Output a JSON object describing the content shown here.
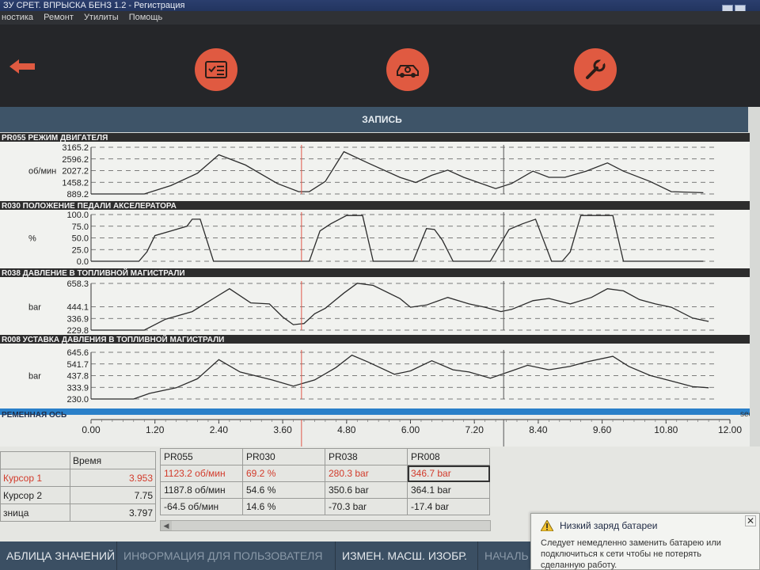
{
  "window": {
    "title": "ЗУ СРЕТ. ВПРЫСКА БЕНЗ 1.2 - Регистрация"
  },
  "menu": [
    "ностика",
    "Ремонт",
    "Утилиты",
    "Помощь"
  ],
  "toolbar": {
    "buttons": [
      {
        "icon": "checklist-icon"
      },
      {
        "icon": "engine-icon"
      },
      {
        "icon": "wrench-icon"
      }
    ],
    "back_icon": "back-arrow-icon",
    "accent": "#e05a41"
  },
  "section_title": "ЗАПИСЬ",
  "time_axis": {
    "title": "РЕМЕННАЯ ОСЬ",
    "unit": "sec",
    "ticks": [
      "0.00",
      "1.20",
      "2.40",
      "3.60",
      "4.80",
      "6.00",
      "7.20",
      "8.40",
      "9.60",
      "10.80",
      "12.00"
    ]
  },
  "chart_data": [
    {
      "type": "line",
      "title": "PR055 РЕЖИМ ДВИГАТЕЛЯ",
      "ylabel": "об/мин",
      "yticks": [
        "3165.2",
        "2596.2",
        "2027.2",
        "1458.2",
        "889.2"
      ],
      "ylim": [
        889.2,
        3165.2
      ],
      "xlim": [
        0,
        12
      ],
      "x": [
        0.0,
        1.0,
        1.5,
        2.0,
        2.4,
        2.9,
        3.5,
        3.9,
        4.1,
        4.4,
        4.75,
        5.2,
        5.8,
        6.1,
        6.4,
        6.7,
        7.0,
        7.6,
        7.9,
        8.3,
        8.6,
        8.9,
        9.3,
        9.7,
        10.0,
        10.5,
        10.9,
        11.5
      ],
      "series": [
        {
          "values": [
            889,
            889,
            1300,
            1900,
            2800,
            2300,
            1400,
            1000,
            1000,
            1500,
            2950,
            2400,
            1700,
            1450,
            1800,
            2050,
            1700,
            1150,
            1400,
            2000,
            1700,
            1700,
            2000,
            2400,
            2000,
            1500,
            1000,
            950
          ]
        }
      ],
      "color": "#2b2b2b"
    },
    {
      "type": "line",
      "title": "R030 ПОЛОЖЕНИЕ ПЕДАЛИ АКСЕЛЕРАТОРА",
      "ylabel": "%",
      "yticks": [
        "100.0",
        "75.0",
        "50.0",
        "25.0",
        "0.0"
      ],
      "ylim": [
        0,
        100
      ],
      "xlim": [
        0,
        12
      ],
      "x": [
        0.0,
        0.9,
        1.05,
        1.2,
        1.5,
        1.8,
        1.9,
        2.05,
        2.3,
        2.6,
        4.1,
        4.3,
        4.5,
        4.8,
        5.1,
        5.3,
        6.05,
        6.3,
        6.45,
        6.6,
        6.8,
        7.5,
        7.85,
        8.1,
        8.35,
        8.65,
        8.85,
        9.0,
        9.2,
        9.8,
        10.0,
        10.2,
        11.5
      ],
      "series": [
        {
          "values": [
            0,
            0,
            20,
            55,
            65,
            75,
            90,
            90,
            0,
            0,
            0,
            65,
            80,
            98,
            98,
            0,
            0,
            70,
            68,
            45,
            0,
            0,
            68,
            80,
            90,
            0,
            0,
            20,
            98,
            98,
            0,
            0,
            0
          ]
        }
      ],
      "color": "#2b2b2b"
    },
    {
      "type": "line",
      "title": "R038 ДАВЛЕНИЕ В ТОПЛИВНОЙ МАГИСТРАЛИ",
      "ylabel": "bar",
      "yticks": [
        "658.3",
        "444.1",
        "336.9",
        "229.8"
      ],
      "ylim": [
        229.8,
        658.3
      ],
      "xlim": [
        0,
        12
      ],
      "x": [
        0.0,
        1.0,
        1.4,
        1.9,
        2.3,
        2.6,
        3.0,
        3.35,
        3.6,
        3.8,
        4.0,
        4.2,
        4.4,
        4.75,
        5.0,
        5.3,
        5.8,
        6.0,
        6.3,
        6.7,
        7.1,
        7.4,
        7.7,
        7.9,
        8.3,
        8.6,
        9.0,
        9.4,
        9.7,
        10.0,
        10.3,
        10.6,
        10.9,
        11.3,
        11.6
      ],
      "series": [
        {
          "values": [
            229.8,
            229.8,
            330,
            400,
            520,
            610,
            480,
            470,
            350,
            280,
            290,
            380,
            430,
            570,
            660,
            640,
            520,
            440,
            460,
            530,
            470,
            440,
            400,
            420,
            500,
            520,
            470,
            530,
            610,
            590,
            510,
            470,
            440,
            340,
            310
          ]
        }
      ],
      "color": "#2b2b2b"
    },
    {
      "type": "line",
      "title": "R008 УСТАВКА ДАВЛЕНИЯ В ТОПЛИВНОЙ МАГИСТРАЛИ",
      "ylabel": "bar",
      "yticks": [
        "645.6",
        "541.7",
        "437.8",
        "333.9",
        "230.0"
      ],
      "ylim": [
        230,
        645.6
      ],
      "xlim": [
        0,
        12
      ],
      "x": [
        0.0,
        0.8,
        1.1,
        1.6,
        2.0,
        2.4,
        2.8,
        3.4,
        3.8,
        4.2,
        4.6,
        4.9,
        5.2,
        5.7,
        6.0,
        6.4,
        6.8,
        7.1,
        7.5,
        7.9,
        8.2,
        8.6,
        9.0,
        9.3,
        9.8,
        10.1,
        10.5,
        10.9,
        11.3,
        11.6
      ],
      "series": [
        {
          "values": [
            230,
            230,
            280,
            330,
            410,
            580,
            470,
            400,
            345,
            400,
            510,
            620,
            560,
            450,
            480,
            570,
            490,
            470,
            415,
            480,
            530,
            490,
            520,
            560,
            610,
            520,
            440,
            390,
            340,
            330
          ]
        }
      ],
      "color": "#2b2b2b"
    }
  ],
  "cursors": {
    "c1_time": 3.953,
    "c2_time": 7.75,
    "c1_color": "#e0574a",
    "c2_color": "#555555"
  },
  "cursor_table": {
    "header": "Время",
    "rows": [
      {
        "name": "Курсор 1",
        "value": "3.953"
      },
      {
        "name": "Курсор 2",
        "value": "7.75"
      },
      {
        "name": "зница",
        "value": "3.797"
      }
    ]
  },
  "values_table": {
    "headers": [
      "PR055",
      "PR030",
      "PR038",
      "PR008"
    ],
    "rows": [
      [
        "1123.2 об/мин",
        "69.2 %",
        "280.3 bar",
        "346.7 bar"
      ],
      [
        "1187.8 об/мин",
        "54.6 %",
        "350.6 bar",
        "364.1 bar"
      ],
      [
        "-64.5 об/мин",
        "14.6 %",
        "-70.3 bar",
        "-17.4 bar"
      ]
    ]
  },
  "tabs": [
    "АБЛИЦА ЗНАЧЕНИЙ",
    "ИНФОРМАЦИЯ ДЛЯ ПОЛЬЗОВАТЕЛЯ",
    "ИЗМЕН. МАСШ. ИЗОБР.",
    "НАЧАЛЬ"
  ],
  "notification": {
    "title": "Низкий заряд батареи",
    "message": "Следует немедленно заменить батарею или подключиться к сети чтобы не потерять сделанную работу.",
    "icon": "warning-icon"
  }
}
